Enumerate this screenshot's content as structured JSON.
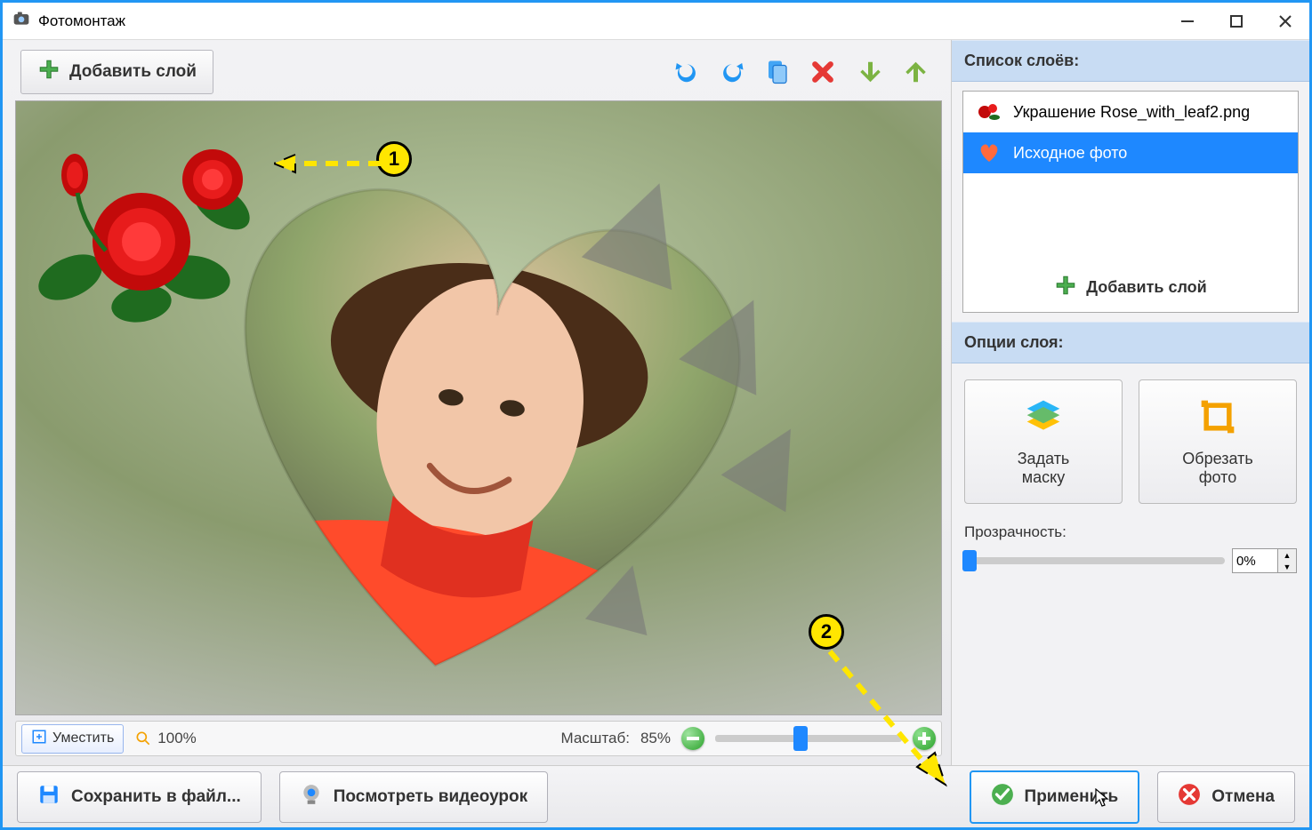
{
  "window": {
    "title": "Фотомонтаж"
  },
  "toolbar": {
    "add_layer": "Добавить слой"
  },
  "canvas": {
    "fit_label": "Уместить",
    "zoom_100": "100%",
    "scale_label": "Масштаб:",
    "scale_value": "85%"
  },
  "right": {
    "layers_header": "Список слоёв:",
    "layers": [
      {
        "label": "Украшение Rose_with_leaf2.png",
        "selected": false
      },
      {
        "label": "Исходное фото",
        "selected": true
      }
    ],
    "add_layer_inside": "Добавить слой",
    "options_header": "Опции слоя:",
    "mask_btn": "Задать\nмаску",
    "crop_btn": "Обрезать\nфото",
    "opacity_label": "Прозрачность:",
    "opacity_value": "0%"
  },
  "bottom": {
    "save_file": "Сохранить в файл...",
    "watch_video": "Посмотреть видеоурок",
    "apply": "Применить",
    "cancel": "Отмена"
  },
  "annotations": {
    "step1": "1",
    "step2": "2"
  }
}
